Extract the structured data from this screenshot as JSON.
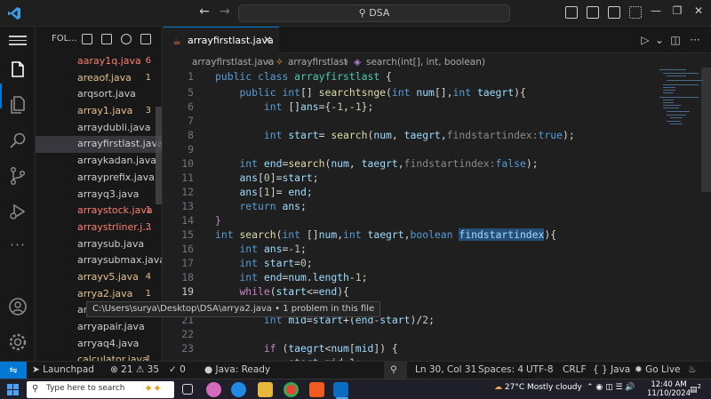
{
  "titlebar": {
    "search_text": "DSA",
    "search_icon": "search-icon",
    "colors": {
      "accent": "#0078d4",
      "background": "#1f1f1f"
    }
  },
  "sidebar": {
    "title": "FOL...",
    "files": [
      {
        "name": "aaray1q.java",
        "badge": "6",
        "status": "error"
      },
      {
        "name": "areaof.java",
        "badge": "1",
        "status": "warning"
      },
      {
        "name": "arqsort.java",
        "badge": "",
        "status": "normal"
      },
      {
        "name": "array1.java",
        "badge": "3",
        "status": "warning"
      },
      {
        "name": "arraydubli.java",
        "badge": "",
        "status": "normal"
      },
      {
        "name": "arrayfirstlast.java",
        "badge": "",
        "status": "selected"
      },
      {
        "name": "arraykadan.java",
        "badge": "",
        "status": "normal"
      },
      {
        "name": "arrayprefix.java",
        "badge": "",
        "status": "normal"
      },
      {
        "name": "arrayq3.java",
        "badge": "",
        "status": "normal"
      },
      {
        "name": "arraystock.java",
        "badge": "1",
        "status": "error"
      },
      {
        "name": "arraystrliner.j...",
        "badge": "3",
        "status": "error"
      },
      {
        "name": "arraysub.java",
        "badge": "",
        "status": "normal"
      },
      {
        "name": "arraysubmax.java",
        "badge": "",
        "status": "normal"
      },
      {
        "name": "arrayv5.java",
        "badge": "4",
        "status": "warning"
      },
      {
        "name": "arrya2.java",
        "badge": "1",
        "status": "warning"
      },
      {
        "name": "ar",
        "badge": "",
        "status": "normal"
      },
      {
        "name": "arryapair.java",
        "badge": "",
        "status": "normal"
      },
      {
        "name": "arryaq4.java",
        "badge": "",
        "status": "normal"
      },
      {
        "name": "calculator.java",
        "badge": "1",
        "status": "warning"
      }
    ],
    "tooltip": "C:\\Users\\surya\\Desktop\\DSA\\arrya2.java • 1 problem in this file"
  },
  "editor": {
    "tab_label": "arrayfirstlast.java",
    "breadcrumbs": [
      "arrayfirstlast.java",
      "arrayfirstlast",
      "search(int[], int, boolean)"
    ],
    "line_numbers": [
      "1",
      "5",
      "6",
      "7",
      "8",
      "9",
      "10",
      "11",
      "12",
      "13",
      "14",
      "15",
      "16",
      "17",
      "18",
      "19",
      "20",
      "21",
      "22",
      "23"
    ],
    "cursor_line": "19"
  },
  "status": {
    "launchpad": "Launchpad",
    "errors": "21",
    "warnings": "35",
    "ports": "0",
    "java": "Java: Ready",
    "position": "Ln 30, Col 31",
    "spaces": "Spaces: 4",
    "encoding": "UTF-8",
    "eol": "CRLF",
    "language": "Java",
    "golive": "Go Live"
  },
  "taskbar": {
    "search_placeholder": "Type here to search",
    "weather": "27°C  Mostly cloudy",
    "time": "12:40 AM",
    "date": "11/10/2024",
    "notification_count": "2"
  }
}
